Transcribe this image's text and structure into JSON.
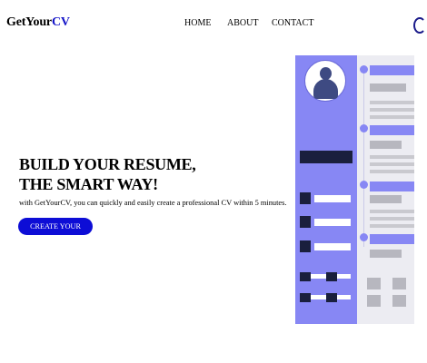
{
  "header": {
    "logo_prefix": "GetYour",
    "logo_accent": "CV",
    "nav": [
      "HOME",
      "ABOUT",
      "CONTACT"
    ]
  },
  "hero": {
    "title_line1": "BUILD YOUR RESUME,",
    "title_line2": "THE SMART WAY!",
    "subtitle": "with GetYourCV, you can quickly and easily create a professional CV within 5 minutes.",
    "cta_label": "CREATE YOUR RESUME"
  },
  "illustration": {
    "icon": "resume-illustration",
    "colors": {
      "accent": "#8787f4",
      "dark": "#1a1f3d",
      "grey": "#b7b7bf",
      "cta": "#0d0dd6",
      "logo_accent": "#1515c8"
    }
  }
}
